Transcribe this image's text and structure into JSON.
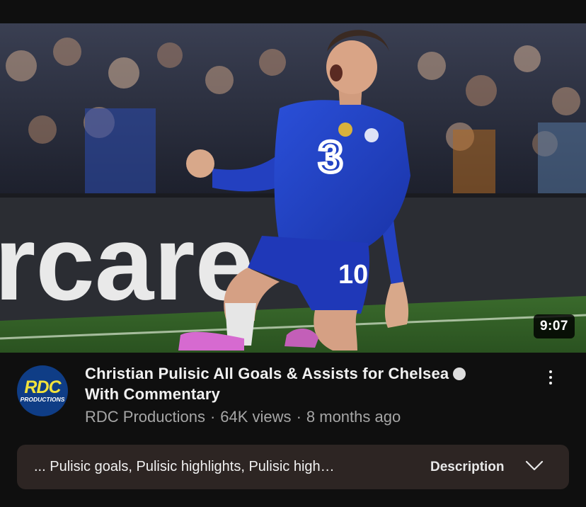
{
  "video": {
    "duration": "9:07",
    "title": "Christian Pulisic All Goals & Assists for Chelsea",
    "title_line2": "With Commentary",
    "channel": "RDC Productions",
    "views": "64K views",
    "age": "8 months ago",
    "separator": "·"
  },
  "avatar": {
    "line1": "RDC",
    "line2": "PRODUCTIONS"
  },
  "thumbnail": {
    "board_text": "rcare",
    "shirt_number": "10",
    "sponsor": "3"
  },
  "description": {
    "preview": "... Pulisic goals, Pulisic highlights, Pulisic high…",
    "label": "Description"
  },
  "icons": {
    "verified": "verified-icon",
    "more": "more-vertical-icon",
    "chevron": "chevron-down-icon"
  },
  "colors": {
    "background": "#0f0f0f",
    "card": "#2d2523",
    "avatar": "#0f3d86"
  }
}
